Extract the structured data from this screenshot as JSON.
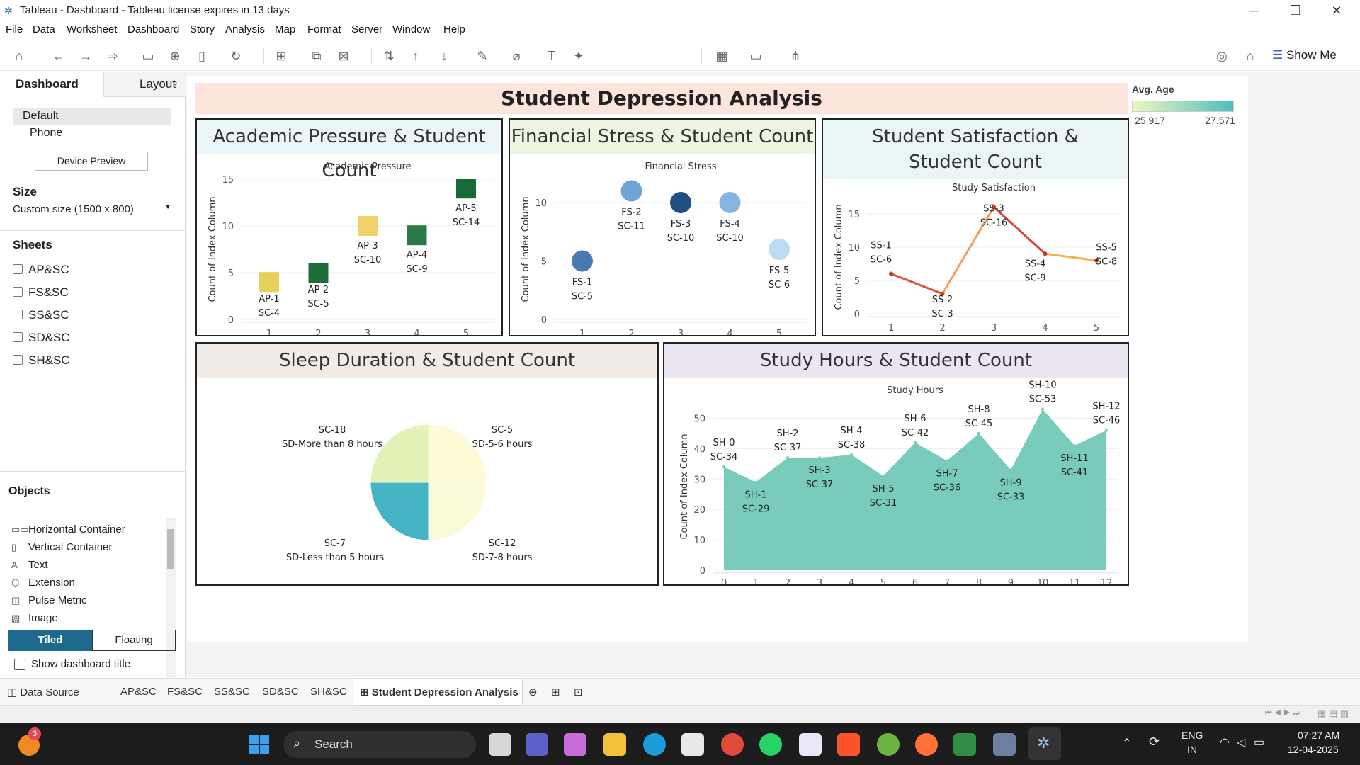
{
  "window": {
    "title": "Tableau - Dashboard - Tableau license expires in 13 days"
  },
  "menu": [
    "File",
    "Data",
    "Worksheet",
    "Dashboard",
    "Story",
    "Analysis",
    "Map",
    "Format",
    "Server",
    "Window",
    "Help"
  ],
  "toolbar": {
    "show_me": "Show Me"
  },
  "left_panel": {
    "tabs": [
      "Dashboard",
      "Layout"
    ],
    "devices": [
      "Default",
      "Phone"
    ],
    "device_preview": "Device Preview",
    "size_label": "Size",
    "size_value": "Custom size (1500 x 800)",
    "sheets_label": "Sheets",
    "sheets": [
      "AP&SC",
      "FS&SC",
      "SS&SC",
      "SD&SC",
      "SH&SC"
    ],
    "objects_label": "Objects",
    "objects": [
      "Horizontal Container",
      "Vertical Container",
      "Text",
      "Extension",
      "Pulse Metric",
      "Image"
    ],
    "tiled": "Tiled",
    "floating": "Floating",
    "show_title": "Show dashboard title"
  },
  "dashboard": {
    "title": "Student Depression Analysis",
    "legend": {
      "title": "Avg. Age",
      "min": "25.917",
      "max": "27.571",
      "color_low": "#eef7c0",
      "color_high": "#4dbfbf"
    },
    "panes": {
      "ap": {
        "title": "Academic Pressure & Student Count",
        "header_color": "#eaf6f7"
      },
      "fs": {
        "title": "Financial Stress & Student Count",
        "header_color": "#eef6e2"
      },
      "ss": {
        "title": "Student Satisfaction & Student Count",
        "header_color": "#eaf6f5"
      },
      "sd": {
        "title": "Sleep Duration & Student Count",
        "header_color": "#f2ece8"
      },
      "sh": {
        "title": "Study Hours & Student Count",
        "header_color": "#ebe6f2"
      }
    }
  },
  "chart_data": [
    {
      "type": "scatter",
      "title": "Academic Pressure",
      "ylabel": "Count of Index Column",
      "ylim": [
        0,
        15
      ],
      "yticks": [
        0,
        5,
        10,
        15
      ],
      "x": [
        1,
        2,
        3,
        4,
        5
      ],
      "values": [
        4,
        5,
        10,
        9,
        14
      ],
      "labels": [
        [
          "AP-1",
          "SC-4"
        ],
        [
          "AP-2",
          "SC-5"
        ],
        [
          "AP-3",
          "SC-10"
        ],
        [
          "AP-4",
          "SC-9"
        ],
        [
          "AP-5",
          "SC-14"
        ]
      ],
      "colors": [
        "#e6d25a",
        "#1f6b3a",
        "#f0d06a",
        "#2a7a45",
        "#1a6a38"
      ]
    },
    {
      "type": "scatter",
      "title": "Financial Stress",
      "ylabel": "Count of Index Column",
      "ylim": [
        0,
        12
      ],
      "yticks": [
        0,
        5,
        10
      ],
      "x": [
        1,
        2,
        3,
        4,
        5
      ],
      "values": [
        5,
        11,
        10,
        10,
        6
      ],
      "labels": [
        [
          "FS-1",
          "SC-5"
        ],
        [
          "FS-2",
          "SC-11"
        ],
        [
          "FS-3",
          "SC-10"
        ],
        [
          "FS-4",
          "SC-10"
        ],
        [
          "FS-5",
          "SC-6"
        ]
      ],
      "colors": [
        "#4a78b0",
        "#6fa3d4",
        "#214e82",
        "#85b6e0",
        "#b9dcf2"
      ]
    },
    {
      "type": "line",
      "title": "Study Satisfaction",
      "ylabel": "Count of Index Column",
      "ylim": [
        0,
        17
      ],
      "yticks": [
        0,
        5,
        10,
        15
      ],
      "x": [
        1,
        2,
        3,
        4,
        5
      ],
      "values": [
        6,
        3,
        16,
        9,
        8
      ],
      "labels": [
        [
          "SS-1",
          "SC-6"
        ],
        [
          "SS-2",
          "SC-3"
        ],
        [
          "SS-3",
          "SC-16"
        ],
        [
          "SS-4",
          "SC-9"
        ],
        [
          "SS-5",
          "SC-8"
        ]
      ]
    },
    {
      "type": "pie",
      "title": "",
      "slices": [
        {
          "label": [
            "SC-5",
            "SD-5-6 hours"
          ],
          "value": 5,
          "color": "#fcfbd6"
        },
        {
          "label": [
            "SC-12",
            "SD-7-8 hours"
          ],
          "value": 12,
          "color": "#fbfad8"
        },
        {
          "label": [
            "SC-7",
            "SD-Less than 5 hours"
          ],
          "value": 7,
          "color": "#45b5c3"
        },
        {
          "label": [
            "SC-18",
            "SD-More than 8 hours"
          ],
          "value": 18,
          "color": "#e2f2b8"
        }
      ]
    },
    {
      "type": "area",
      "title": "Study Hours",
      "ylabel": "Count of Index Column",
      "ylim": [
        0,
        55
      ],
      "yticks": [
        0,
        10,
        20,
        30,
        40,
        50
      ],
      "x": [
        0,
        1,
        2,
        3,
        4,
        5,
        6,
        7,
        8,
        9,
        10,
        11,
        12
      ],
      "values": [
        34,
        29,
        37,
        37,
        38,
        31,
        42,
        36,
        45,
        33,
        53,
        41,
        46
      ],
      "labels": [
        [
          "SH-0",
          "SC-34"
        ],
        [
          "SH-1",
          "SC-29"
        ],
        [
          "SH-2",
          "SC-37"
        ],
        [
          "SH-3",
          "SC-37"
        ],
        [
          "SH-4",
          "SC-38"
        ],
        [
          "SH-5",
          "SC-31"
        ],
        [
          "SH-6",
          "SC-42"
        ],
        [
          "SH-7",
          "SC-36"
        ],
        [
          "SH-8",
          "SC-45"
        ],
        [
          "SH-9",
          "SC-33"
        ],
        [
          "SH-10",
          "SC-53"
        ],
        [
          "SH-11",
          "SC-41"
        ],
        [
          "SH-12",
          "SC-46"
        ]
      ],
      "color": "#79cbbc"
    }
  ],
  "sheet_tabs": [
    "Data Source",
    "AP&SC",
    "FS&SC",
    "SS&SC",
    "SD&SC",
    "SH&SC",
    "Student Depression Analysis"
  ],
  "taskbar": {
    "search": "Search",
    "lang1": "ENG",
    "lang2": "IN",
    "time": "07:27 AM",
    "date": "12-04-2025",
    "badge": "3"
  }
}
